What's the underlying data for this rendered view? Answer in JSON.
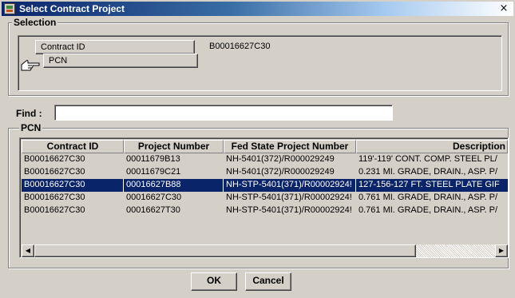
{
  "window": {
    "title": "Select Contract Project",
    "close_glyph": "×"
  },
  "selection": {
    "group_label": "Selection",
    "contract_id_button": "Contract ID",
    "contract_id_value": "B00016627C30",
    "pcn_button": "PCN",
    "pointer_icon": "hand-pointer-icon"
  },
  "find": {
    "label": "Find :",
    "value": "",
    "placeholder": ""
  },
  "pcn": {
    "group_label": "PCN",
    "columns": [
      "Contract ID",
      "Project Number",
      "Fed State Project Number",
      "Description"
    ],
    "rows": [
      [
        "B00016627C30",
        "00011679B13",
        "NH-5401(372)/R000029249",
        "119'-119' CONT. COMP. STEEL PL/"
      ],
      [
        "B00016627C30",
        "00011679C21",
        "NH-5401(372)/R000029249",
        "0.231 MI. GRADE, DRAIN., ASP. P/"
      ],
      [
        "B00016627C30",
        "00016627B88",
        "NH-STP-5401(371)/R00002924!",
        "127-156-127 FT. STEEL PLATE GIF"
      ],
      [
        "B00016627C30",
        "00016627C30",
        "NH-STP-5401(371)/R00002924!",
        "0.761 MI. GRADE, DRAIN., ASP. P/"
      ],
      [
        "B00016627C30",
        "00016627T30",
        "NH-STP-5401(371)/R00002924!",
        "0.761 MI. GRADE, DRAIN., ASP. P/"
      ]
    ],
    "selected_row": 2
  },
  "buttons": {
    "ok": "OK",
    "cancel": "Cancel"
  },
  "colors": {
    "selection_bg": "#0a246a",
    "window_bg": "#d4d0c8",
    "title_gradient_start": "#0a246a"
  }
}
